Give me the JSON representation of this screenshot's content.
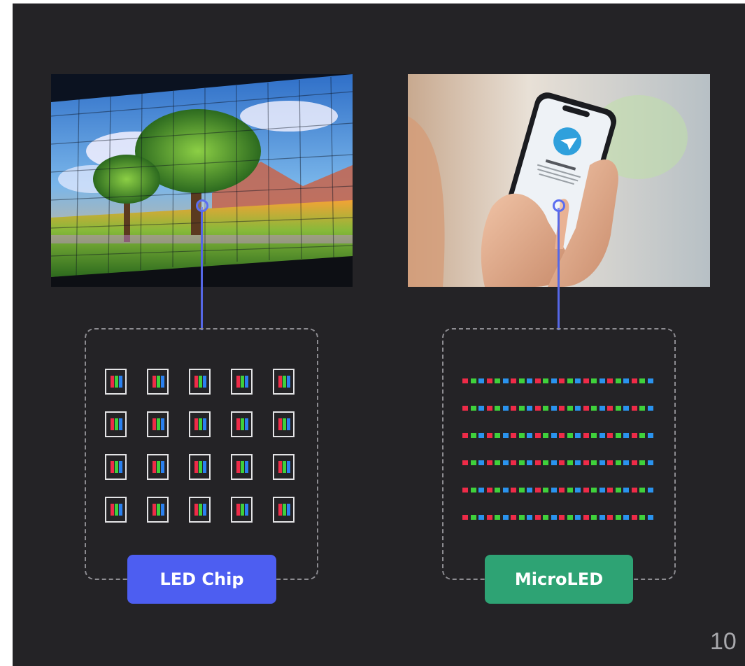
{
  "left": {
    "photo": "video-wall-photo",
    "label": "LED Chip",
    "label_color": "#4d5ef1",
    "chip_rows": 4,
    "chip_cols": 5,
    "chip_colors": [
      "#ee2b48",
      "#3fd13b",
      "#2a80f0"
    ]
  },
  "right": {
    "photo": "smartphone-photo",
    "label": "MicroLED",
    "label_color": "#2ea374",
    "pixel_rows": 6,
    "pixels_per_row": 24,
    "pixel_colors": [
      "#ee2b48",
      "#3fd13b",
      "#2a93ee"
    ]
  },
  "connector_color": "#5567e6",
  "page_number": "10"
}
